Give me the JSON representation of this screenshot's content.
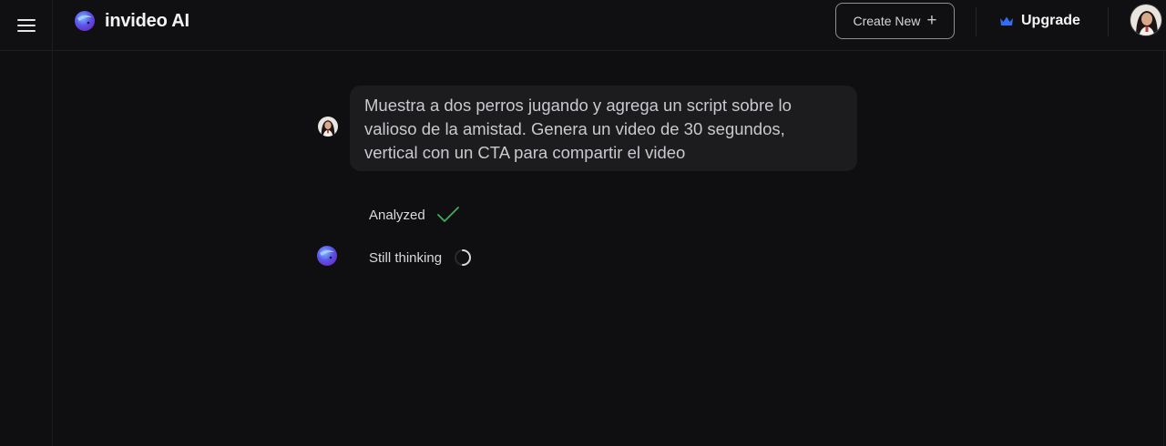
{
  "header": {
    "brand_name": "invideo AI",
    "create_new_label": "Create New",
    "upgrade_label": "Upgrade"
  },
  "conversation": {
    "user_message": "Muestra a dos perros jugando y agrega un script sobre lo valioso de la amistad. Genera un video de 30 segundos, vertical con un CTA para compartir el video",
    "statuses": [
      {
        "label": "Analyzed",
        "state": "done",
        "icon": "checkmark-icon"
      },
      {
        "label": "Still thinking",
        "state": "loading",
        "icon": "spinner-icon"
      }
    ]
  },
  "colors": {
    "background": "#0f0f11",
    "bubble": "#1c1c1f",
    "success": "#3fae5a",
    "crown": "#2f6df6"
  }
}
